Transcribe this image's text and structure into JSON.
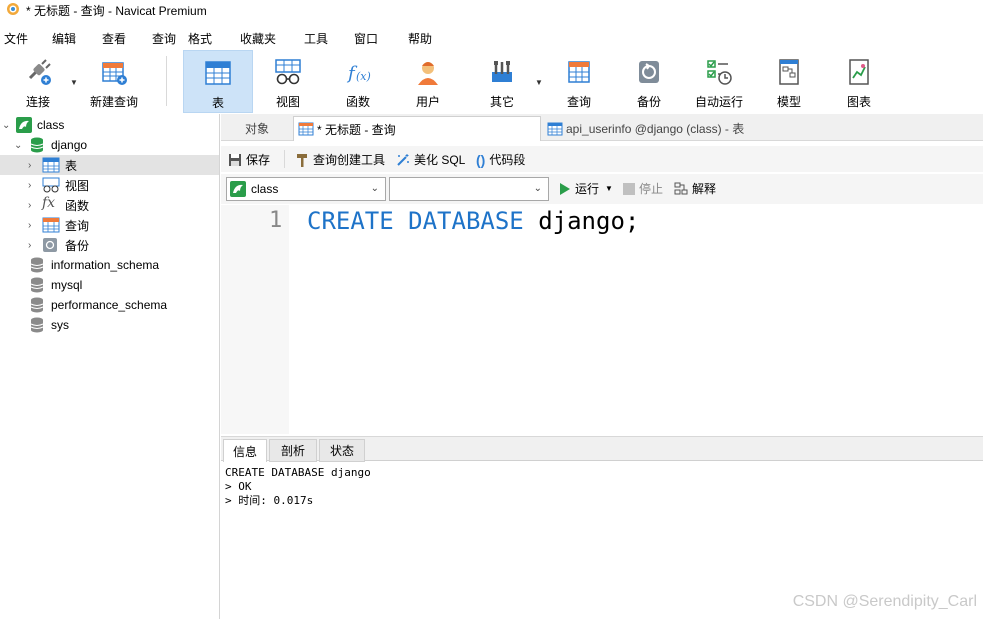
{
  "window": {
    "title": "* 无标题 - 查询 - Navicat Premium"
  },
  "menu": [
    "文件",
    "编辑",
    "查看",
    "查询",
    "格式",
    "收藏夹",
    "工具",
    "窗口",
    "帮助"
  ],
  "toolbar": {
    "connect": "连接",
    "new_query": "新建查询",
    "table": "表",
    "view": "视图",
    "function": "函数",
    "user": "用户",
    "other": "其它",
    "query": "查询",
    "backup": "备份",
    "automation": "自动运行",
    "model": "模型",
    "chart": "图表"
  },
  "nav": {
    "connection": "class",
    "database": "django",
    "children": [
      "表",
      "视图",
      "函数",
      "查询",
      "备份"
    ],
    "other_dbs": [
      "information_schema",
      "mysql",
      "performance_schema",
      "sys"
    ]
  },
  "tabs": {
    "objects": "对象",
    "query_tab": "* 无标题 - 查询",
    "table_tab": "api_userinfo @django (class) - 表"
  },
  "editor_toolbar": {
    "save": "保存",
    "query_builder": "查询创建工具",
    "beautify": "美化 SQL",
    "snippet": "代码段"
  },
  "selectors": {
    "connection": "class",
    "database": "",
    "run": "运行",
    "stop": "停止",
    "explain": "解释"
  },
  "editor": {
    "line_number": "1",
    "kw1": "CREATE",
    "kw2": "DATABASE",
    "rest": " django;"
  },
  "bottom_tabs": {
    "info": "信息",
    "profile": "剖析",
    "status": "状态"
  },
  "output": {
    "line1": "CREATE DATABASE django",
    "line2": "> OK",
    "line3": "> 时间: 0.017s"
  },
  "watermark": "CSDN @Serendipity_Carl"
}
